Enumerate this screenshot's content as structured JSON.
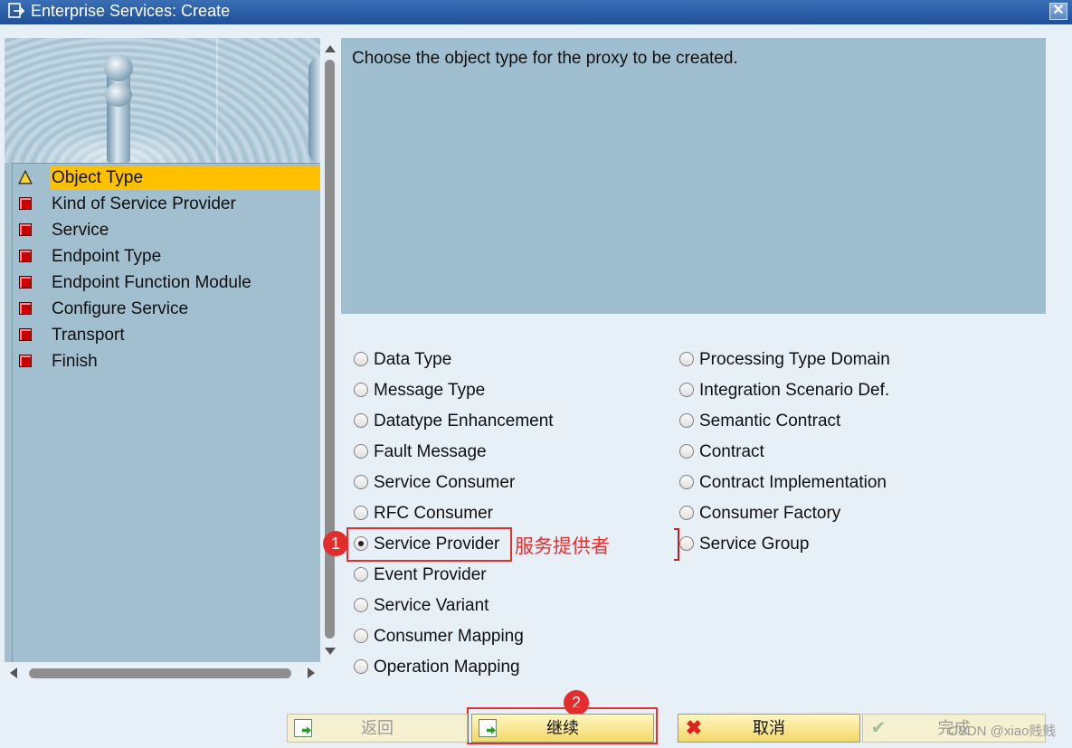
{
  "window": {
    "title": "Enterprise Services: Create",
    "close_label": "✕"
  },
  "steps": [
    {
      "label": "Object Type",
      "status": "current"
    },
    {
      "label": "Kind of Service Provider",
      "status": "pending"
    },
    {
      "label": "Service",
      "status": "pending"
    },
    {
      "label": "Endpoint Type",
      "status": "pending"
    },
    {
      "label": "Endpoint Function Module",
      "status": "pending"
    },
    {
      "label": "Configure Service",
      "status": "pending"
    },
    {
      "label": "Transport",
      "status": "pending"
    },
    {
      "label": "Finish",
      "status": "pending"
    }
  ],
  "info": {
    "message": "Choose the object type for the proxy to be created."
  },
  "options_left": [
    {
      "label": "Data Type",
      "selected": false
    },
    {
      "label": "Message Type",
      "selected": false
    },
    {
      "label": "Datatype Enhancement",
      "selected": false
    },
    {
      "label": "Fault Message",
      "selected": false
    },
    {
      "label": "Service Consumer",
      "selected": false
    },
    {
      "label": "RFC Consumer",
      "selected": false
    },
    {
      "label": "Service Provider",
      "selected": true
    },
    {
      "label": "Event Provider",
      "selected": false
    },
    {
      "label": "Service Variant",
      "selected": false
    },
    {
      "label": "Consumer Mapping",
      "selected": false
    },
    {
      "label": "Operation Mapping",
      "selected": false
    }
  ],
  "options_right": [
    {
      "label": "Processing Type Domain",
      "selected": false
    },
    {
      "label": "Integration Scenario Def.",
      "selected": false
    },
    {
      "label": "Semantic Contract",
      "selected": false
    },
    {
      "label": "Contract",
      "selected": false
    },
    {
      "label": "Contract Implementation",
      "selected": false
    },
    {
      "label": "Consumer Factory",
      "selected": false
    },
    {
      "label": "Service Group",
      "selected": false
    }
  ],
  "annotations": {
    "marker1": "1",
    "marker2": "2",
    "note": "服务提供者"
  },
  "buttons": {
    "back": "返回",
    "continue": "继续",
    "cancel": "取消",
    "complete": "完成"
  },
  "watermark": "CSDN @xiao贱贱",
  "colors": {
    "title_bar": "#2a5ea8",
    "panel": "#a2bfd0",
    "active_step": "#ffc000",
    "annotation": "#e03030"
  }
}
